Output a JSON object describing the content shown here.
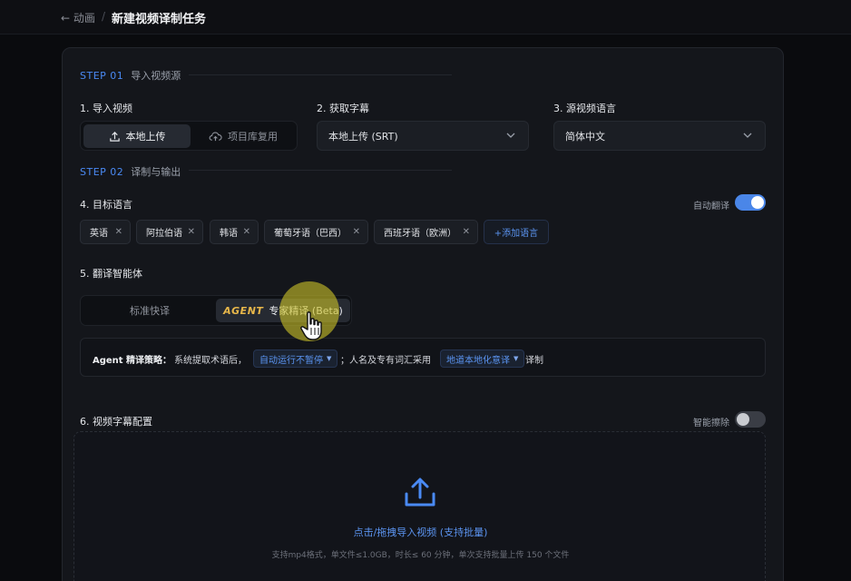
{
  "breadcrumb": {
    "back": "← 动画",
    "separator": "/",
    "title": "新建视频译制任务"
  },
  "step1": {
    "num": "STEP 01",
    "title": "导入视频源"
  },
  "step2": {
    "num": "STEP 02",
    "title": "译制与输出"
  },
  "import_video": {
    "label": "1. 导入视频",
    "options": [
      {
        "label": "本地上传",
        "icon": "upload-icon",
        "active": true
      },
      {
        "label": "项目库复用",
        "icon": "cloud-upload-icon",
        "active": false
      }
    ]
  },
  "subtitle": {
    "label": "2. 获取字幕",
    "value": "本地上传 (SRT)"
  },
  "source_lang": {
    "label": "3. 源视频语言",
    "value": "简体中文"
  },
  "target_lang": {
    "label": "4. 目标语言",
    "auto_translate_label": "自动翻译",
    "auto_translate_on": true,
    "chips": [
      "英语",
      "阿拉伯语",
      "韩语",
      "葡萄牙语（巴西）",
      "西班牙语（欧洲）"
    ],
    "add_label": "+添加语言"
  },
  "agent": {
    "label": "5. 翻译智能体",
    "options": [
      {
        "label": "标准快译",
        "active": false
      },
      {
        "badge": "AGENT",
        "label": "专家精译 (Beta)",
        "active": true
      }
    ]
  },
  "strategy": {
    "title": "Agent 精译策略：",
    "text1": "系统提取术语后，",
    "pill1": "自动运行不暂停",
    "text2": "；人名及专有词汇采用",
    "pill2": "地道本地化意译",
    "text3": "译制"
  },
  "video_subtitle": {
    "label": "6. 视频字幕配置",
    "smart_erase_label": "智能擦除",
    "smart_erase_on": false
  },
  "dropzone": {
    "title": "点击/拖拽导入视频 (支持批量)",
    "hint": "支持mp4格式，单文件≤1.0GB，时长≤ 60 分钟，单次支持批量上传 150 个文件"
  },
  "colors": {
    "accent": "#4a86e8",
    "agent_badge": "#e8b74a",
    "cursor_highlight": "#c8be28"
  }
}
